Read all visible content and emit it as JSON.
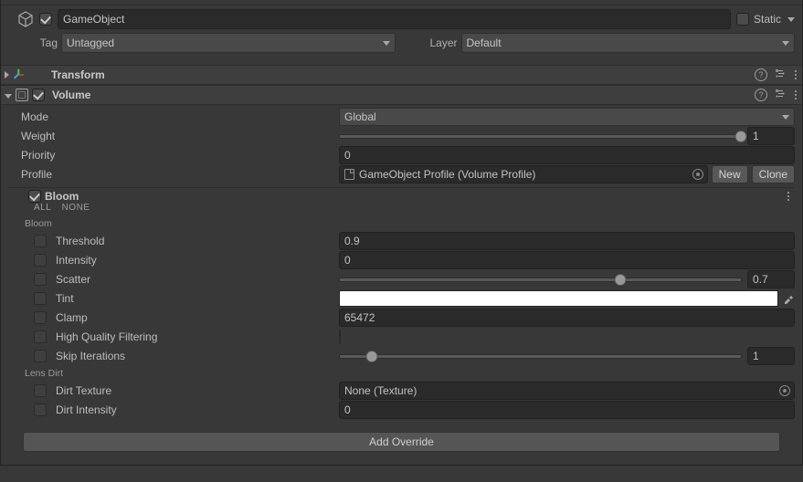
{
  "header": {
    "name": "GameObject",
    "enabled": true,
    "static_label": "Static",
    "tag_label": "Tag",
    "tag_value": "Untagged",
    "layer_label": "Layer",
    "layer_value": "Default"
  },
  "components": {
    "transform": {
      "title": "Transform",
      "expanded": false
    },
    "volume": {
      "title": "Volume",
      "expanded": true,
      "enabled": true,
      "mode": {
        "label": "Mode",
        "value": "Global"
      },
      "weight": {
        "label": "Weight",
        "value": "1",
        "percent": 100
      },
      "priority": {
        "label": "Priority",
        "value": "0"
      },
      "profile": {
        "label": "Profile",
        "value": "GameObject Profile (Volume Profile)",
        "new_btn": "New",
        "clone_btn": "Clone"
      },
      "overrides": {
        "bloom": {
          "title": "Bloom",
          "all": "ALL",
          "none": "NONE",
          "group_bloom": "Bloom",
          "threshold": {
            "label": "Threshold",
            "value": "0.9"
          },
          "intensity": {
            "label": "Intensity",
            "value": "0"
          },
          "scatter": {
            "label": "Scatter",
            "value": "0.7",
            "percent": 70
          },
          "tint": {
            "label": "Tint",
            "color": "#ffffff"
          },
          "clamp": {
            "label": "Clamp",
            "value": "65472"
          },
          "hqfilter": {
            "label": "High Quality Filtering",
            "checked": false
          },
          "skip": {
            "label": "Skip Iterations",
            "value": "1",
            "percent": 8
          },
          "group_lensdirt": "Lens Dirt",
          "dirt_texture": {
            "label": "Dirt Texture",
            "value": "None (Texture)"
          },
          "dirt_intensity": {
            "label": "Dirt Intensity",
            "value": "0"
          }
        }
      },
      "add_override_label": "Add Override"
    }
  }
}
